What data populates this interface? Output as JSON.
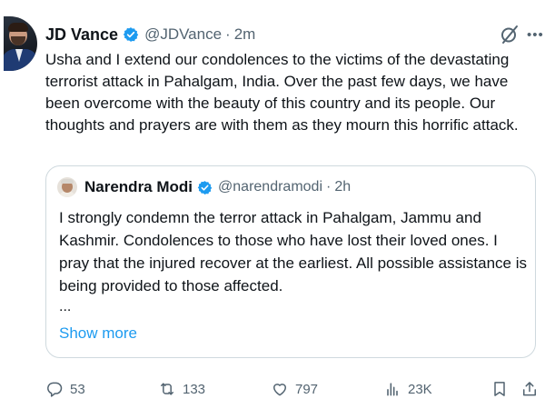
{
  "tweet": {
    "author_name": "JD Vance",
    "handle": "@JDVance",
    "separator": "·",
    "time": "2m",
    "text": "Usha and I extend our condolences to the victims of the devastating terrorist attack in Pahalgam, India. Over the past few days, we have been overcome with the beauty of this country and its people. Our thoughts and prayers are with them as they mourn this horrific attack."
  },
  "quoted": {
    "author_name": "Narendra Modi",
    "handle": "@narendramodi",
    "separator": "·",
    "time": "2h",
    "text": "I strongly condemn the terror attack in Pahalgam, Jammu and Kashmir. Condolences to those who have lost their loved ones. I pray that the injured recover at the earliest. All possible assistance is being provided to those affected.",
    "ellipsis": "...",
    "show_more_label": "Show more"
  },
  "actions": {
    "replies": "53",
    "reposts": "133",
    "likes": "797",
    "views": "23K"
  },
  "icons": [
    "avatar",
    "verified-badge-icon",
    "grok-icon",
    "more-icon",
    "reply-icon",
    "repost-icon",
    "like-icon",
    "views-icon",
    "bookmark-icon",
    "share-icon"
  ],
  "colors": {
    "accent": "#1d9bf0",
    "text": "#0f1419",
    "muted": "#536471",
    "border": "#cfd9de"
  }
}
